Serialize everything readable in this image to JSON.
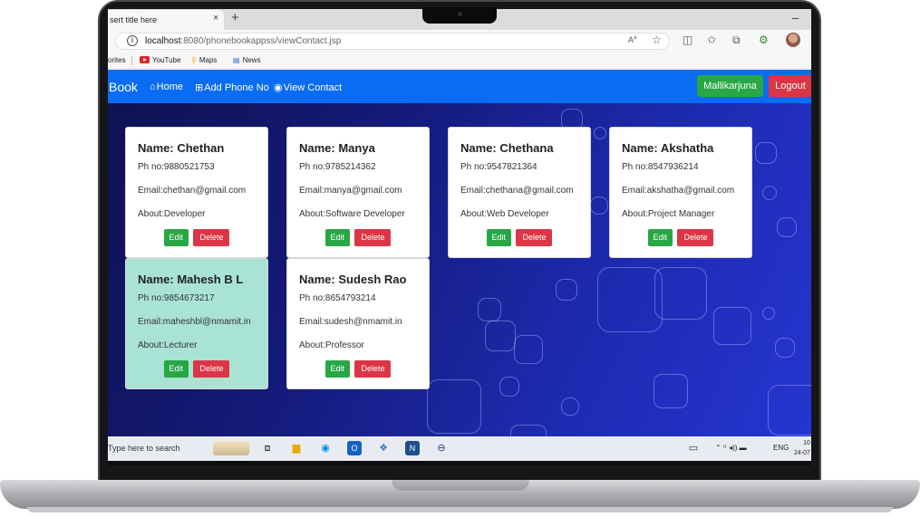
{
  "browser": {
    "tab_title": "sert title here",
    "tab_close": "×",
    "new_tab": "+",
    "minimize": "–",
    "url_host": "localhost",
    "url_rest": ":8080/phonebookappss/viewContact.jsp",
    "favorites": {
      "partial": "orites",
      "youtube": "YouTube",
      "maps": "Maps",
      "news": "News"
    }
  },
  "nav": {
    "brand": "Book",
    "home": "Home",
    "add": "Add Phone No",
    "view": "View Contact",
    "user_button": "Mallikarjuna",
    "logout_button": "Logout"
  },
  "contacts": [
    {
      "name": "Name: Chethan",
      "phone": "Ph no:9880521753",
      "email": "Email:chethan@gmail.com",
      "about": "About:Developer",
      "edit": "Edit",
      "delete": "Delete"
    },
    {
      "name": "Name: Manya",
      "phone": "Ph no:9785214362",
      "email": "Email:manya@gmail.com",
      "about": "About:Software Developer",
      "edit": "Edit",
      "delete": "Delete"
    },
    {
      "name": "Name: Chethana",
      "phone": "Ph no:9547821364",
      "email": "Email:chethana@gmail.com",
      "about": "About:Web Developer",
      "edit": "Edit",
      "delete": "Delete"
    },
    {
      "name": "Name: Akshatha",
      "phone": "Ph no:8547936214",
      "email": "Email:akshatha@gmail.com",
      "about": "About:Project Manager",
      "edit": "Edit",
      "delete": "Delete"
    },
    {
      "name": "Name: Mahesh B L",
      "phone": "Ph no:9854673217",
      "email": "Email:maheshbl@nmamit.in",
      "about": "About:Lecturer",
      "edit": "Edit",
      "delete": "Delete"
    },
    {
      "name": "Name: Sudesh Rao",
      "phone": "Ph no:8654793214",
      "email": "Email:sudesh@nmamit.in",
      "about": "About:Professor",
      "edit": "Edit",
      "delete": "Delete"
    }
  ],
  "taskbar": {
    "search_placeholder": "Type here to search",
    "language": "ENG",
    "time": "10",
    "date": "24-07"
  },
  "colors": {
    "navbar": "#0a6cf2",
    "success": "#28a745",
    "danger": "#dc3545",
    "highlight_card": "#a9e3d4"
  }
}
